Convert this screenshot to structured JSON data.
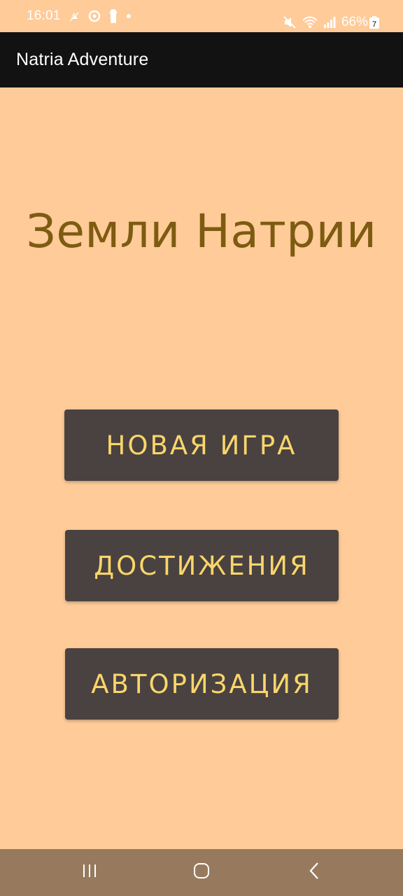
{
  "status_bar": {
    "time": "16:01",
    "battery": "66%",
    "battery_level": "7",
    "icons": [
      "notification-icon",
      "sync-icon",
      "keyhole-icon",
      "dot-icon",
      "mute-icon",
      "wifi-icon",
      "signal-icon",
      "battery-icon"
    ]
  },
  "app_bar": {
    "title": "Natria Adventure"
  },
  "main": {
    "title": "Земли Натрии",
    "buttons": {
      "new_game": "НОВАЯ ИГРА",
      "achievements": "ДОСТИЖЕНИЯ",
      "auth": "АВТОРИЗАЦИЯ"
    }
  },
  "nav_bar": {
    "icons": [
      "recents-icon",
      "home-icon",
      "back-icon"
    ]
  },
  "colors": {
    "background": "#FECB99",
    "app_bar": "#121212",
    "title_text": "#7D5B10",
    "button_bg": "#4A4240",
    "button_text": "#F9D66B",
    "nav_bar": "#977A5E"
  }
}
